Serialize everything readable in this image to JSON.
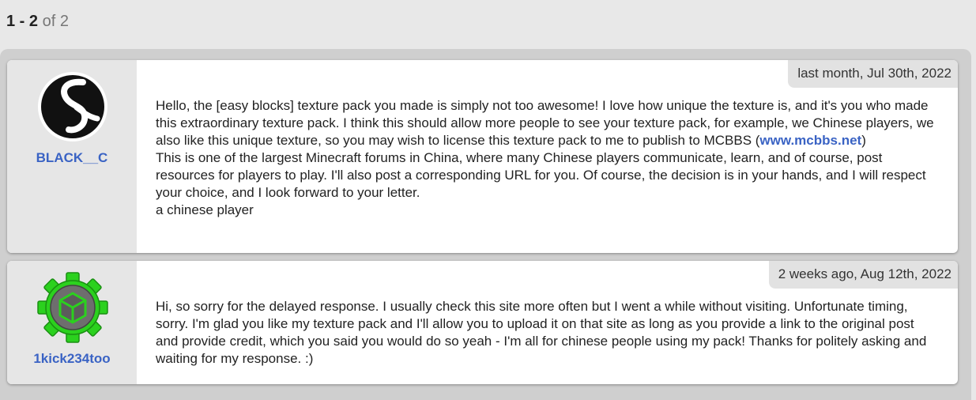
{
  "pagination": {
    "range_start": "1",
    "sep": " - ",
    "range_end": "2",
    "of_text": " of 2"
  },
  "posts": [
    {
      "author": "BLACK__C",
      "avatar_icon": "black-circle-s-logo-icon",
      "date": "last month, Jul 30th, 2022",
      "para1_before": "Hello, the [easy blocks] texture pack you made is simply not too awesome! I love how unique the texture is, and it's you who made this extraordinary texture pack. I think this should allow more people to see your texture pack, for example, we Chinese players, we also like this unique texture, so you may wish to license this texture pack to me to publish to MCBBS (",
      "link_text": "www.mcbbs.net",
      "para1_after": ")",
      "para2": "This is one of the largest Minecraft forums in China, where many Chinese players communicate, learn, and of course, post resources for players to play. I'll also post a corresponding URL for you. Of course, the decision is in your hands, and I will respect your choice, and I look forward to your letter.",
      "para3": "a chinese player"
    },
    {
      "author": "1kick234too",
      "avatar_icon": "green-gear-cube-icon",
      "date": "2 weeks ago, Aug 12th, 2022",
      "para1": "Hi, so sorry for the delayed response. I usually check this site more often but I went a while without visiting. Unfortunate timing, sorry. I'm glad you like my texture pack and I'll allow you to upload it on that site as long as you provide a link to the original post and provide credit, which you said you would do so yeah - I'm all for chinese people using my pack! Thanks for politely asking and waiting for my response. :)"
    }
  ],
  "colors": {
    "username_link": "#3a63c4",
    "page_bg": "#e8e8e8",
    "panel_bg": "#cfcfcf",
    "author_col_bg": "#e6e6e6"
  }
}
